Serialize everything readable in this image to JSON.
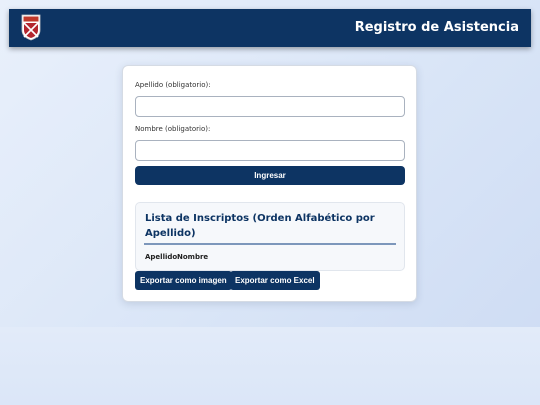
{
  "header": {
    "title": "Registro de Asistencia",
    "logo_icon": "shield-logo-icon",
    "bg_color": "#0d3463"
  },
  "form": {
    "apellido_label": "Apellido (obligatorio):",
    "apellido_value": "",
    "nombre_label": "Nombre (obligatorio):",
    "nombre_value": "",
    "submit_label": "Ingresar"
  },
  "list": {
    "title": "Lista de Inscriptos (Orden Alfabético por Apellido)",
    "columns": [
      "Apellido",
      "Nombre"
    ],
    "rows": []
  },
  "actions": {
    "export_image_label": "Exportar como imagen",
    "export_excel_label": "Exportar como Excel"
  },
  "colors": {
    "primary": "#0d3463",
    "accent": "#7d97bb"
  }
}
